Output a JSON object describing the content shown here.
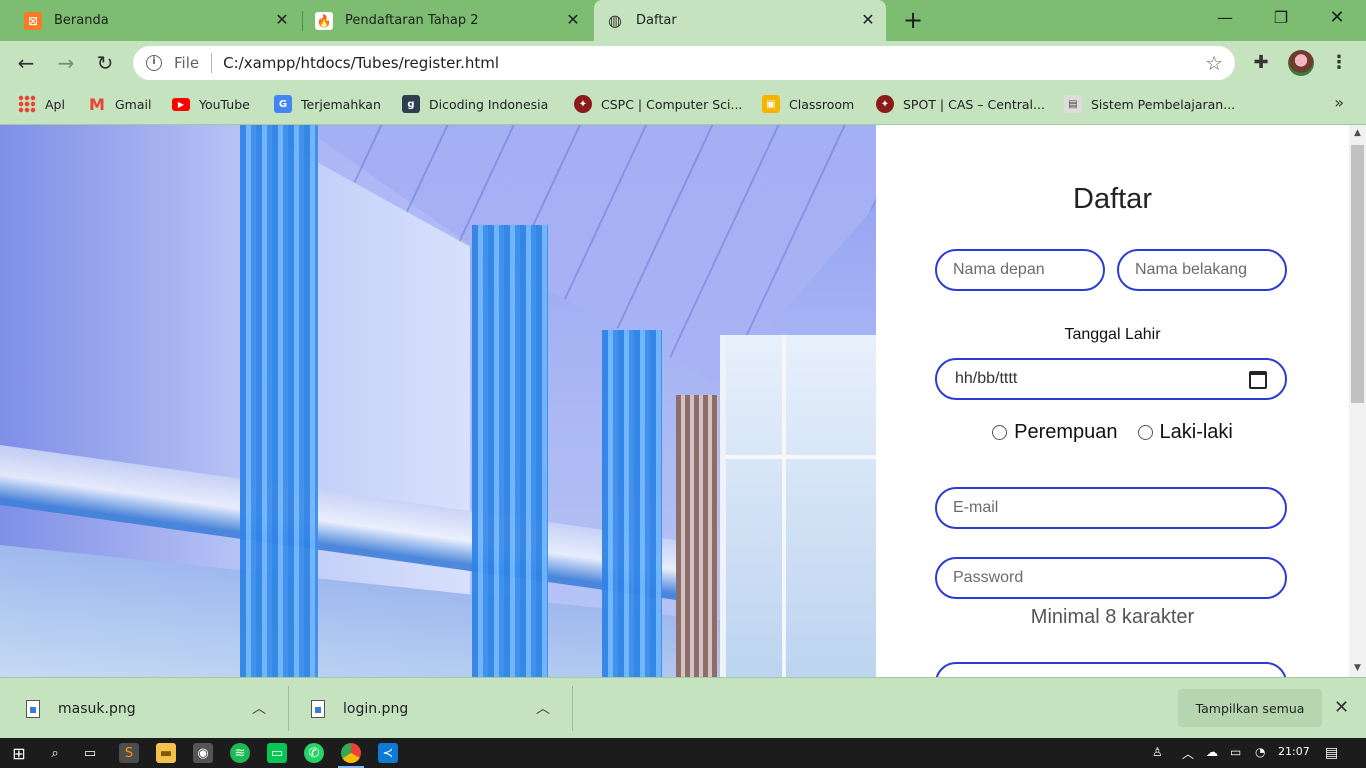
{
  "browser": {
    "tabs": [
      {
        "title": "Beranda",
        "favicon": "xampp-icon",
        "color": "#fb7a24"
      },
      {
        "title": "Pendaftaran Tahap 2",
        "favicon": "codeigniter-flame-icon",
        "color": "#ee4323"
      },
      {
        "title": "Daftar",
        "favicon": "globe-icon",
        "color": "#333333"
      }
    ],
    "address": {
      "scheme_label": "File",
      "url": "C:/xampp/htdocs/Tubes/register.html"
    },
    "bookmarks": [
      {
        "label": "Apl",
        "icon": "apps-grid-icon"
      },
      {
        "label": "Gmail",
        "icon": "gmail-icon"
      },
      {
        "label": "YouTube",
        "icon": "youtube-icon"
      },
      {
        "label": "Terjemahkan",
        "icon": "google-translate-icon"
      },
      {
        "label": "Dicoding Indonesia",
        "icon": "dicoding-icon"
      },
      {
        "label": "CSPC | Computer Sci...",
        "icon": "cspc-icon"
      },
      {
        "label": "Classroom",
        "icon": "classroom-icon"
      },
      {
        "label": "SPOT | CAS – Central...",
        "icon": "spot-icon"
      },
      {
        "label": "Sistem Pembelajaran...",
        "icon": "sistem-icon"
      }
    ]
  },
  "form": {
    "title": "Daftar",
    "first_name_placeholder": "Nama depan",
    "last_name_placeholder": "Nama belakang",
    "dob_label": "Tanggal Lahir",
    "dob_placeholder": "hh/bb/tttt",
    "gender_options": [
      "Perempuan",
      "Laki-laki"
    ],
    "email_placeholder": "E-mail",
    "password_placeholder": "Password",
    "password_hint": "Minimal 8 karakter",
    "accent_color": "#2b3bd6"
  },
  "downloads": {
    "items": [
      {
        "filename": "masuk.png"
      },
      {
        "filename": "login.png"
      }
    ],
    "show_all_label": "Tampilkan semua"
  },
  "taskbar": {
    "clock": "21:07"
  }
}
